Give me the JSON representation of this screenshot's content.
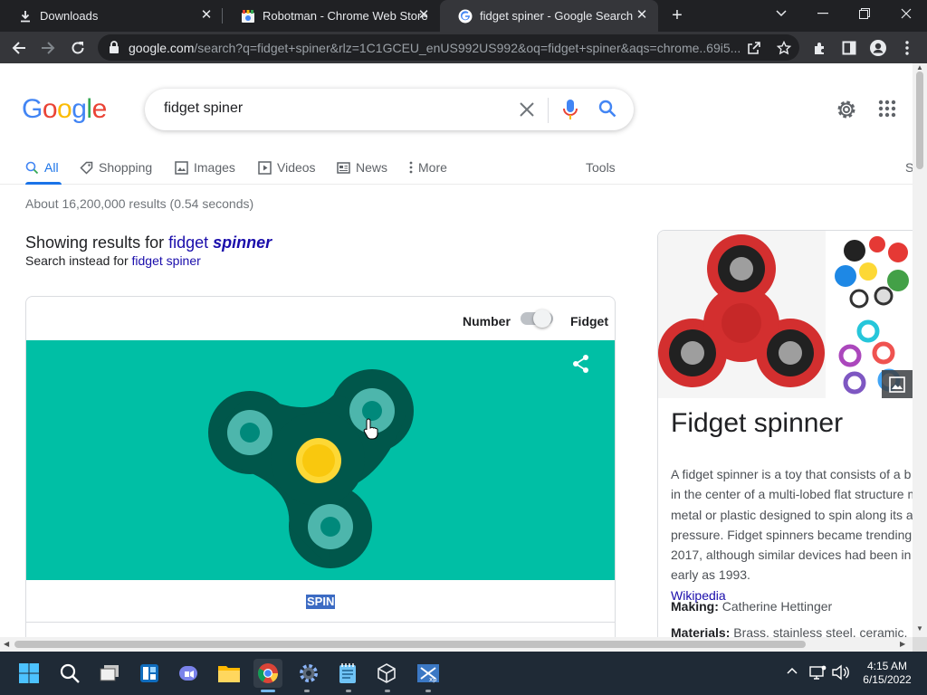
{
  "browser": {
    "tabs": [
      {
        "title": "Downloads",
        "active": false
      },
      {
        "title": "Robotman - Chrome Web Store",
        "active": false
      },
      {
        "title": "fidget spiner - Google Search",
        "active": true
      }
    ],
    "url_host": "google.com",
    "url_rest": "/search?q=fidget+spiner&rlz=1C1GCEU_enUS992US992&oq=fidget+spiner&aqs=chrome..69i5..."
  },
  "search": {
    "logo": "Google",
    "query": "fidget spiner",
    "tabs": [
      "All",
      "Shopping",
      "Images",
      "Videos",
      "News",
      "More"
    ],
    "tools_label": "Tools",
    "cutoff_label": "S",
    "result_stats": "About 16,200,000 results (0.54 seconds)",
    "showing_prefix": "Showing results for ",
    "showing_word1": "fidget",
    "showing_word2": "spinner",
    "instead_prefix": "Search instead for ",
    "instead_link": "fidget spiner"
  },
  "spinner_widget": {
    "toggle_left": "Number",
    "toggle_right": "Fidget",
    "spin_label": "SPIN",
    "colors": {
      "background": "#00bfa5",
      "body": "#00574b",
      "outer_ring": "#4db6ac",
      "center": "#fdd835"
    }
  },
  "knowledge_panel": {
    "title": "Fidget spinner",
    "description_lines": [
      "A fidget spinner is a toy that consists of a b",
      "in the center of a multi-lobed flat structure m",
      "metal or plastic designed to spin along its a",
      "pressure. Fidget spinners became trending",
      "2017, although similar devices had been in",
      "early as 1993. "
    ],
    "source_link": "Wikipedia",
    "facts": [
      {
        "label": "Making:",
        "value": " Catherine Hettinger"
      },
      {
        "label": "Materials:",
        "value": " Brass, stainless steel, ceramic,"
      }
    ]
  },
  "taskbar": {
    "time": "4:15 AM",
    "date": "6/15/2022"
  }
}
